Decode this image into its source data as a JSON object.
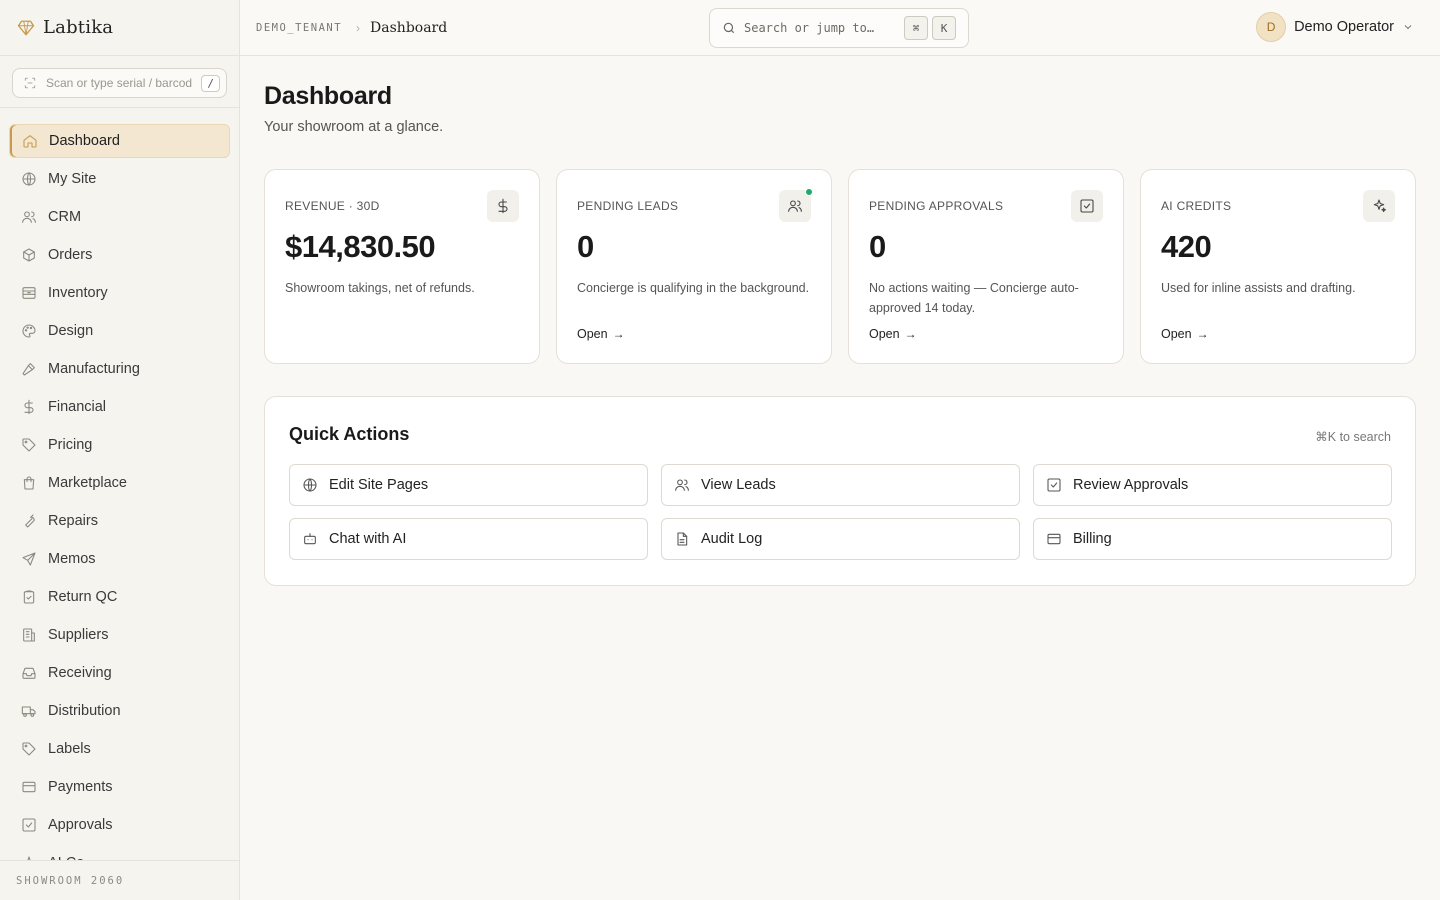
{
  "colors": {
    "accent": "#c79a4d",
    "active_bg": "#f3e7d2",
    "status_green": "#1fa86a"
  },
  "brand": {
    "name": "Labtika",
    "icon": "gem-icon"
  },
  "scan": {
    "placeholder": "Scan or type serial / barcode",
    "shortcut": "/"
  },
  "sidebar": {
    "items": [
      {
        "label": "Dashboard",
        "icon": "home-icon",
        "active": true
      },
      {
        "label": "My Site",
        "icon": "globe-icon"
      },
      {
        "label": "CRM",
        "icon": "users-icon"
      },
      {
        "label": "Orders",
        "icon": "box-icon"
      },
      {
        "label": "Inventory",
        "icon": "archive-icon"
      },
      {
        "label": "Design",
        "icon": "palette-icon"
      },
      {
        "label": "Manufacturing",
        "icon": "hammer-icon"
      },
      {
        "label": "Financial",
        "icon": "dollar-icon"
      },
      {
        "label": "Pricing",
        "icon": "tag-icon"
      },
      {
        "label": "Marketplace",
        "icon": "shopping-bag-icon"
      },
      {
        "label": "Repairs",
        "icon": "wrench-icon"
      },
      {
        "label": "Memos",
        "icon": "send-icon"
      },
      {
        "label": "Return QC",
        "icon": "clipboard-check-icon"
      },
      {
        "label": "Suppliers",
        "icon": "building-icon"
      },
      {
        "label": "Receiving",
        "icon": "inbox-icon"
      },
      {
        "label": "Distribution",
        "icon": "truck-icon"
      },
      {
        "label": "Labels",
        "icon": "tag-icon"
      },
      {
        "label": "Payments",
        "icon": "credit-card-icon"
      },
      {
        "label": "Approvals",
        "icon": "check-square-icon"
      },
      {
        "label": "AI Co",
        "icon": "sparkles-icon"
      }
    ],
    "footer": "SHOWROOM 2060"
  },
  "header": {
    "tenant": "DEMO_TENANT",
    "separator": "›",
    "page": "Dashboard",
    "search_placeholder": "Search or jump to…",
    "search_keys": [
      "⌘",
      "K"
    ],
    "user_initial": "D",
    "user_name": "Demo Operator"
  },
  "main": {
    "title": "Dashboard",
    "subtitle": "Your showroom at a glance.",
    "cards": [
      {
        "label": "REVENUE · 30D",
        "value": "$14,830.50",
        "desc": "Showroom takings, net of refunds.",
        "icon": "dollar-icon",
        "open": ""
      },
      {
        "label": "PENDING LEADS",
        "value": "0",
        "desc": "Concierge is qualifying in the background.",
        "icon": "users-icon",
        "open": "Open"
      },
      {
        "label": "PENDING APPROVALS",
        "value": "0",
        "desc": "No actions waiting — Concierge auto-approved 14 today.",
        "icon": "check-square-icon",
        "open": "Open"
      },
      {
        "label": "AI CREDITS",
        "value": "420",
        "desc": "Used for inline assists and drafting.",
        "icon": "sparkles-icon",
        "open": "Open"
      }
    ],
    "quick_actions": {
      "title": "Quick Actions",
      "hint": "⌘K to search",
      "items": [
        {
          "label": "Edit Site Pages",
          "icon": "globe-icon"
        },
        {
          "label": "View Leads",
          "icon": "users-icon"
        },
        {
          "label": "Review Approvals",
          "icon": "check-square-icon"
        },
        {
          "label": "Chat with AI",
          "icon": "bot-icon"
        },
        {
          "label": "Audit Log",
          "icon": "file-text-icon"
        },
        {
          "label": "Billing",
          "icon": "credit-card-icon"
        }
      ]
    }
  }
}
